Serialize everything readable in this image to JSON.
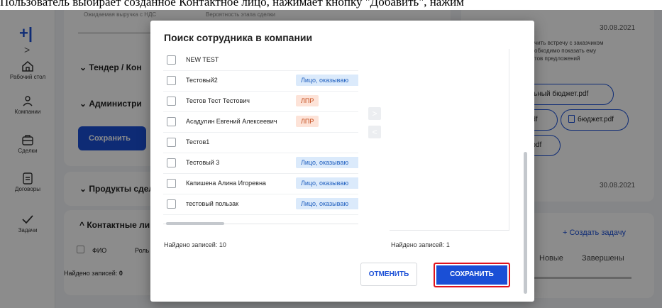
{
  "caption": "Пользователь выбирает созданное Контактное лицо, нажимает кнопку \"Добавить\", нажим",
  "sidebar": {
    "items": [
      {
        "label": "Рабочий стол",
        "icon": "home-icon"
      },
      {
        "label": "Компании",
        "icon": "people-icon"
      },
      {
        "label": "Сделки",
        "icon": "briefcase-icon"
      },
      {
        "label": "Договоры",
        "icon": "document-icon"
      },
      {
        "label": "Задачи",
        "icon": "check-icon"
      }
    ]
  },
  "background": {
    "revenue_label": "Ожидаемая выручка с НДС",
    "probability_label": "Вероятность этапа сделки",
    "tender_section": "Тендер / Кон",
    "admin_section": "Администри",
    "save_button": "Сохранить",
    "products_section": "Продукты сдел",
    "contacts_section": "Контактные ли",
    "col_fio": "ФИО",
    "col_role": "Роль",
    "found_records": "Найдено записей:",
    "found_count": "0",
    "right_date1": "30.08.2021",
    "right_text1": "чить встречу с заказчиком",
    "right_text2": "обходимо показать ему",
    "right_text3": "тов предложений",
    "file1": "ельный бюджет.pdf",
    "file2": ".pdf",
    "file3": "бюджет.pdf",
    "file4": "5.pdf",
    "right_date2": "30.08.2021",
    "create_task": "+ Создать задачу",
    "tab_new": "Новые",
    "tab_done": "Завершены"
  },
  "modal": {
    "title": "Поиск сотрудника в компании",
    "rows": [
      {
        "name": "NEW TEST",
        "tag": "",
        "tag_color": ""
      },
      {
        "name": "Тестовый2",
        "tag": "Лицо, оказываю",
        "tag_color": "blue"
      },
      {
        "name": "Тестов Тест Тестович",
        "tag": "ЛПР",
        "tag_color": "red"
      },
      {
        "name": "Асадулин Евгений Алексеевич",
        "tag": "ЛПР",
        "tag_color": "red"
      },
      {
        "name": "Тестов1",
        "tag": "",
        "tag_color": ""
      },
      {
        "name": "Тестовый 3",
        "tag": "Лицо, оказываю",
        "tag_color": "blue"
      },
      {
        "name": "Капишена Алина Игоревна",
        "tag": "Лицо, оказываю",
        "tag_color": "blue"
      },
      {
        "name": "тестовый пользак",
        "tag": "Лицо, оказываю",
        "tag_color": "blue"
      }
    ],
    "move_right": ">",
    "move_left": "<",
    "found_left": "Найдено записей: 10",
    "found_right": "Найдено записей: 1",
    "cancel_label": "ОТМЕНИТЬ",
    "save_label": "СОХРАНИТЬ"
  },
  "colors": {
    "accent": "#1a4fd6",
    "highlight_border": "#e0141e",
    "tag_blue_bg": "#dbeafb",
    "tag_red_bg": "#fde3d8"
  }
}
